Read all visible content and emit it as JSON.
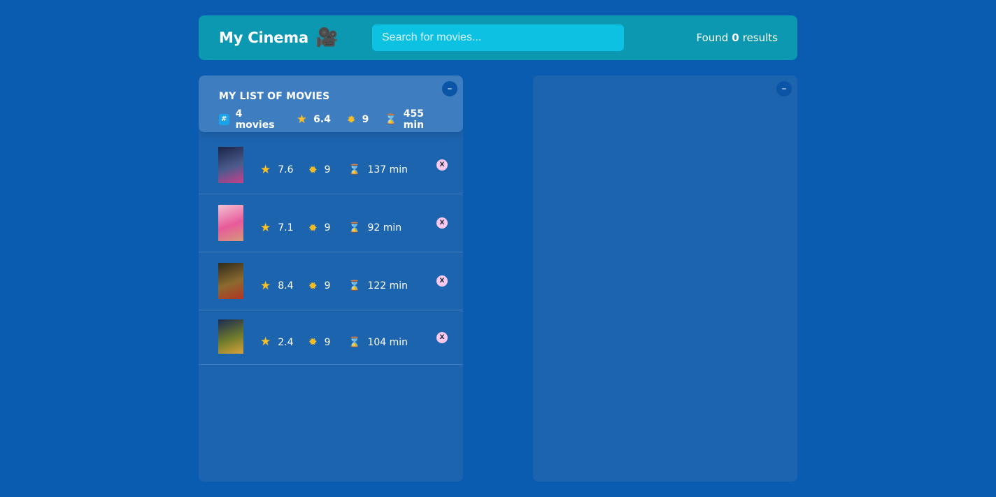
{
  "header": {
    "title": "My Cinema",
    "logo_icon": "🎥",
    "search_placeholder": "Search for movies...",
    "search_value": "",
    "found_prefix": "Found",
    "found_count": "0",
    "found_suffix": "results"
  },
  "watched": {
    "toggle_label": "–",
    "summary": {
      "title": "MY LIST OF MOVIES",
      "count_icon": "#",
      "count_label": "4 movies",
      "avg_imdb": "6.4",
      "avg_user": "9",
      "avg_runtime": "455 min"
    },
    "movies": [
      {
        "imdb": "7.6",
        "user": "9",
        "runtime": "137 min",
        "remove_label": "X",
        "poster_colors": [
          "#1b2448",
          "#4a5b8c",
          "#c93f8b"
        ]
      },
      {
        "imdb": "7.1",
        "user": "9",
        "runtime": "92 min",
        "remove_label": "X",
        "poster_colors": [
          "#f2c2d3",
          "#e85a9a",
          "#d49a7a"
        ]
      },
      {
        "imdb": "8.4",
        "user": "9",
        "runtime": "122 min",
        "remove_label": "X",
        "poster_colors": [
          "#2e2a1b",
          "#8b6a2f",
          "#b43325"
        ]
      },
      {
        "imdb": "2.4",
        "user": "9",
        "runtime": "104 min",
        "remove_label": "X",
        "poster_colors": [
          "#1c2b52",
          "#6f7b2c",
          "#d9a33a"
        ]
      }
    ]
  },
  "results": {
    "toggle_label": "–"
  },
  "icons": {
    "star": "★",
    "sun": "✹",
    "hourglass": "⌛"
  },
  "colors": {
    "background": "#095cb0",
    "header": "#0c98b1",
    "search": "#0dc1e2",
    "panel": "#1d64af",
    "summary": "#3e7dbf",
    "star": "#fbbf24",
    "remove": "#fbc8ef"
  }
}
